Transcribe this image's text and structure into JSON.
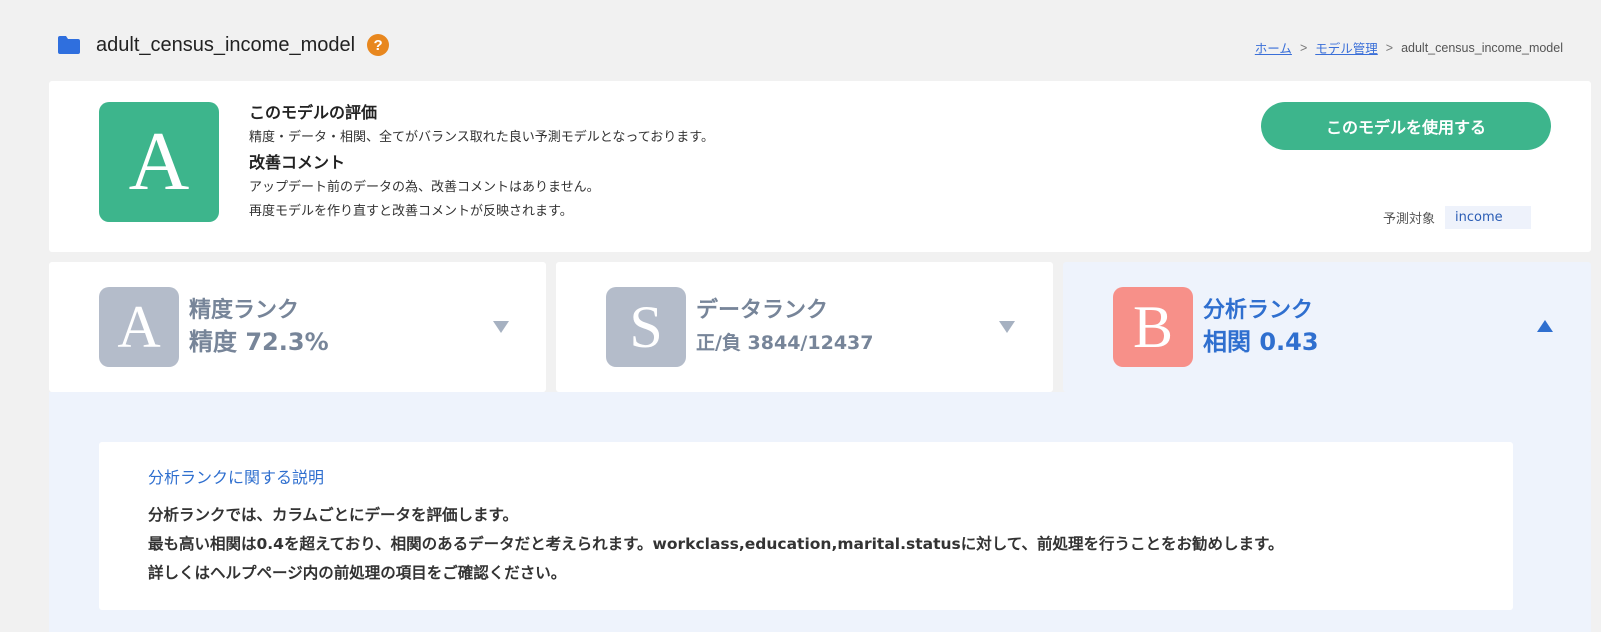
{
  "header": {
    "title": "adult_census_income_model",
    "folder_icon": "folder-icon",
    "help_icon": "help-icon",
    "help_symbol": "?"
  },
  "breadcrumb": {
    "items": [
      "ホーム",
      "モデル管理",
      "adult_census_income_model"
    ],
    "separator": ">"
  },
  "evaluation": {
    "grade": "A",
    "grade_color": "#3db58c",
    "heading": "このモデルの評価",
    "description": "精度・データ・相関、全てがバランス取れた良い予測モデルとなっております。",
    "improvement_heading": "改善コメント",
    "improvement_lines": [
      "アップデート前のデータの為、改善コメントはありません。",
      "再度モデルを作り直すと改善コメントが反映されます。"
    ],
    "use_button": "このモデルを使用する",
    "target_label": "予測対象",
    "target_value": "income"
  },
  "ranks": [
    {
      "grade": "A",
      "title": "精度ランク",
      "value": "精度 72.3%",
      "color": "#b4bcca",
      "expanded": false,
      "icon": "chevron-down-icon"
    },
    {
      "grade": "S",
      "title": "データランク",
      "value": "正/負 3844/12437",
      "color": "#b4bcca",
      "expanded": false,
      "icon": "chevron-down-icon"
    },
    {
      "grade": "B",
      "title": "分析ランク",
      "value": "相関 0.43",
      "color": "#f79089",
      "expanded": true,
      "icon": "chevron-up-icon"
    }
  ],
  "detail": {
    "heading": "分析ランクに関する説明",
    "lines": [
      "分析ランクでは、カラムごとにデータを評価します。",
      "最も高い相関は0.4を超えており、相関のあるデータだと考えられます。workclass,education,marital.statusに対して、前処理を行うことをお勧めします。",
      "詳しくはヘルプページ内の前処理の項目をご確認ください。"
    ]
  },
  "colors": {
    "accent": "#3db58c",
    "link": "#3a6fd8",
    "analysis_blue": "#2f6fcf",
    "help_orange": "#e8871e"
  }
}
